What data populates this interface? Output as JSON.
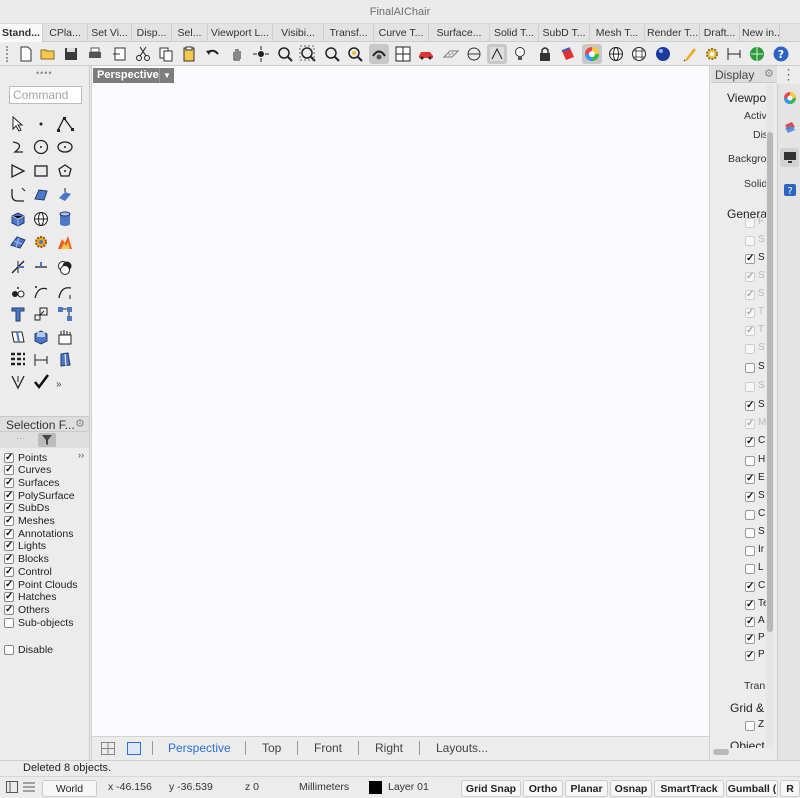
{
  "window": {
    "title": "FinalAIChair"
  },
  "tabs": [
    {
      "label": "Stand..."
    },
    {
      "label": "CPla..."
    },
    {
      "label": "Set Vi..."
    },
    {
      "label": "Disp..."
    },
    {
      "label": "Sel..."
    },
    {
      "label": "Viewport L..."
    },
    {
      "label": "Visibi..."
    },
    {
      "label": "Transf..."
    },
    {
      "label": "Curve T..."
    },
    {
      "label": "Surface..."
    },
    {
      "label": "Solid T..."
    },
    {
      "label": "SubD T..."
    },
    {
      "label": "Mesh T..."
    },
    {
      "label": "Render T..."
    },
    {
      "label": "Draft..."
    },
    {
      "label": "New in..."
    }
  ],
  "toolbar": {
    "icons": [
      "new-file-icon",
      "open-folder-icon",
      "save-icon",
      "print-icon",
      "import-icon",
      "cut-icon",
      "copy-icon",
      "paste-icon",
      "undo-icon",
      "pan-hand-icon",
      "rotate-view-icon",
      "zoom-icon",
      "zoom-window-icon",
      "zoom-extents-icon",
      "zoom-selected-icon",
      "rotate-3d-icon",
      "four-viewports-icon",
      "car-icon",
      "grid-plane-icon",
      "target-icon",
      "osnap-icon",
      "light-bulb-icon",
      "lock-icon",
      "paint-bucket-icon",
      "color-wheel-icon",
      "sphere-icon",
      "globe-mesh-icon",
      "render-ball-icon",
      "pen-icon",
      "gear-options-icon",
      "dimension-icon",
      "globe-icon",
      "help-icon"
    ]
  },
  "command": {
    "placeholder": "Command"
  },
  "tools": [
    "select-arrow-icon",
    "point-icon",
    "polyline-icon",
    "curve-icon",
    "circle-icon",
    "ellipse-icon",
    "arc-icon",
    "rectangle-icon",
    "polygon-icon",
    "fillet-icon",
    "surface-icon",
    "extrude-icon",
    "box-icon",
    "sphere-icon",
    "cylinder-icon",
    "mesh-icon",
    "gear-solid-icon",
    "explosion-icon",
    "trim-icon",
    "split-icon",
    "boolean-icon",
    "points-icon",
    "curve-edit-icon",
    "rebuild-icon",
    "text-icon",
    "scale-icon",
    "array-icon",
    "draft-icon",
    "block-icon",
    "solid-icon",
    "grid-array-icon",
    "dimension-icon",
    "paint-icon",
    "transform-icon",
    "check-icon"
  ],
  "selection_filter": {
    "title": "Selection F...",
    "items": [
      {
        "label": "Points",
        "checked": true
      },
      {
        "label": "Curves",
        "checked": true
      },
      {
        "label": "Surfaces",
        "checked": true
      },
      {
        "label": "PolySurface",
        "checked": true
      },
      {
        "label": "SubDs",
        "checked": true
      },
      {
        "label": "Meshes",
        "checked": true
      },
      {
        "label": "Annotations",
        "checked": true
      },
      {
        "label": "Lights",
        "checked": true
      },
      {
        "label": "Blocks",
        "checked": true
      },
      {
        "label": "Control",
        "checked": true
      },
      {
        "label": "Point Clouds",
        "checked": true
      },
      {
        "label": "Hatches",
        "checked": true
      },
      {
        "label": "Others",
        "checked": true
      },
      {
        "label": "Sub-objects",
        "checked": false
      }
    ],
    "disable": {
      "label": "Disable",
      "checked": false
    }
  },
  "viewport": {
    "label": "Perspective",
    "tabs": [
      {
        "label": "Perspective",
        "active": true
      },
      {
        "label": "Top",
        "active": false
      },
      {
        "label": "Front",
        "active": false
      },
      {
        "label": "Right",
        "active": false
      },
      {
        "label": "Layouts...",
        "active": false
      }
    ]
  },
  "display_panel": {
    "title": "Display",
    "section_viewport": "Viewpo",
    "row_active": "Activ",
    "row_display": "Dis",
    "row_background": "Backgro",
    "row_solid": "Solid",
    "section_general": "Genera",
    "checks": [
      {
        "label": "F",
        "checked": false,
        "dim": true
      },
      {
        "label": "S",
        "checked": false,
        "dim": true
      },
      {
        "label": "S",
        "checked": true,
        "dim": false
      },
      {
        "label": "S",
        "checked": true,
        "dim": true
      },
      {
        "label": "S",
        "checked": true,
        "dim": true
      },
      {
        "label": "T",
        "checked": true,
        "dim": true
      },
      {
        "label": "T",
        "checked": true,
        "dim": true
      },
      {
        "label": "S",
        "checked": false,
        "dim": true
      },
      {
        "label": "S",
        "checked": false,
        "dim": false
      },
      {
        "label": "S",
        "checked": false,
        "dim": true
      },
      {
        "label": "S",
        "checked": true,
        "dim": false
      },
      {
        "label": "M",
        "checked": true,
        "dim": true
      },
      {
        "label": "C",
        "checked": true,
        "dim": false
      },
      {
        "label": "H",
        "checked": false,
        "dim": false
      },
      {
        "label": "E",
        "checked": true,
        "dim": false
      },
      {
        "label": "S",
        "checked": true,
        "dim": false
      },
      {
        "label": "C",
        "checked": false,
        "dim": false
      },
      {
        "label": "S",
        "checked": false,
        "dim": false
      },
      {
        "label": "Ir",
        "checked": false,
        "dim": false
      },
      {
        "label": "L",
        "checked": false,
        "dim": false
      },
      {
        "label": "C",
        "checked": true,
        "dim": false
      },
      {
        "label": "Te",
        "checked": true,
        "dim": false
      },
      {
        "label": "A",
        "checked": true,
        "dim": false
      },
      {
        "label": "P",
        "checked": true,
        "dim": false
      },
      {
        "label": "P",
        "checked": true,
        "dim": false
      }
    ],
    "row_transparency": "Tran",
    "section_grid": "Grid &",
    "grid_check": {
      "label": "Z",
      "checked": false
    },
    "section_objects": "Object"
  },
  "status": {
    "message": "Deleted 8 objects.",
    "cplane": "World",
    "x": "x -46.156",
    "y": "y -36.539",
    "z": "z 0",
    "units": "Millimeters",
    "layer": "Layer 01",
    "buttons": [
      "Grid Snap",
      "Ortho",
      "Planar",
      "Osnap",
      "SmartTrack",
      "Gumball (",
      "R"
    ]
  },
  "colors": {
    "active_tab_blue": "#2d6fd3",
    "viewport_bg": "#fbfbfd",
    "viewport_label_bg": "#7d7d7d"
  }
}
